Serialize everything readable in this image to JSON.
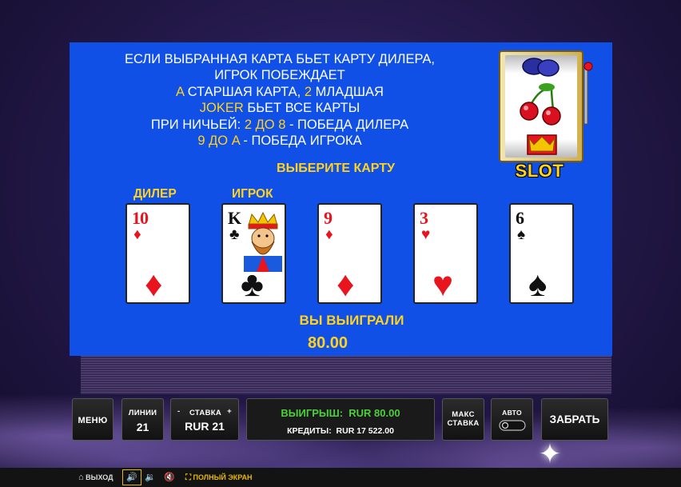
{
  "rules": {
    "line1": "ЕСЛИ ВЫБРАННАЯ КАРТА БЬЕТ КАРТУ ДИЛЕРА,",
    "line2": "ИГРОК ПОБЕЖДАЕТ",
    "line3_a": "A",
    "line3_b": " СТАРШАЯ КАРТА, ",
    "line3_c": "2",
    "line3_d": " МЛАДШАЯ",
    "line4_a": "JOKER",
    "line4_b": " БЬЕТ ВСЕ КАРТЫ",
    "line5_a": "ПРИ НИЧЬЕЙ: ",
    "line5_b": "2 ДО 8",
    "line5_c": " - ПОБЕДА ДИЛЕРА",
    "line6_a": "9 ДО A",
    "line6_b": " - ПОБЕДА ИГРОКА"
  },
  "prompt": "ВЫБЕРИТЕ КАРТУ",
  "labels": {
    "dealer": "ДИЛЕР",
    "player": "ИГРОК"
  },
  "cards": [
    {
      "rank": "10",
      "suit": "♦",
      "color": "red"
    },
    {
      "rank": "K",
      "suit": "♣",
      "color": "black"
    },
    {
      "rank": "9",
      "suit": "♦",
      "color": "red"
    },
    {
      "rank": "3",
      "suit": "♥",
      "color": "red"
    },
    {
      "rank": "6",
      "suit": "♠",
      "color": "black"
    }
  ],
  "slot": {
    "title": "SLOT",
    "symbols": [
      "plum",
      "cherry",
      "crown"
    ]
  },
  "result": {
    "title": "ВЫ ВЫИГРАЛИ",
    "amount": "80.00"
  },
  "controls": {
    "menu": "МЕНЮ",
    "lines_label": "ЛИНИИ",
    "lines_value": "21",
    "bet_minus": "-",
    "bet_label": "СТАВКА",
    "bet_plus": "+",
    "bet_value": "RUR 21",
    "win_label": "ВЫИГРЫШ:",
    "win_value": "RUR 80.00",
    "credits_label": "КРЕДИТЫ:",
    "credits_value": "RUR 17 522.00",
    "max_line1": "МАКС",
    "max_line2": "СТАВКА",
    "auto": "АВТО",
    "collect": "ЗАБРАТЬ"
  },
  "bottom_bar": {
    "exit": "ВЫХОД",
    "fullscreen": "ПОЛНЫЙ ЭКРАН"
  },
  "colors": {
    "panel": "#1050e6",
    "accent": "#ffd21e",
    "win_green": "#4ccf3a"
  }
}
